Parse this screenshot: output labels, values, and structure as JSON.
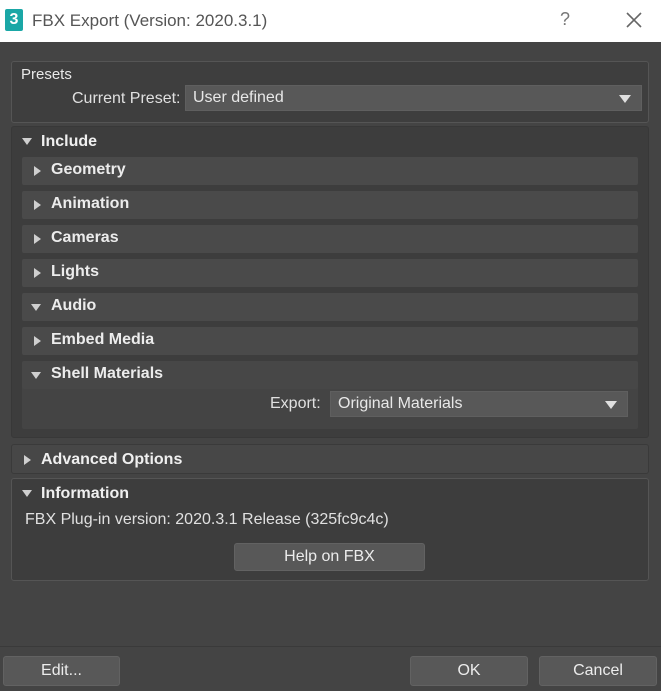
{
  "window": {
    "title": "FBX Export (Version: 2020.3.1)",
    "help_glyph": "?",
    "app_icon_glyph": "3",
    "icons": {
      "app": "3dsmax-app-icon",
      "help": "help-icon",
      "close": "close-icon"
    }
  },
  "presets": {
    "title": "Presets",
    "current_label": "Current Preset:",
    "current_value": "User defined"
  },
  "include": {
    "title": "Include",
    "items": [
      {
        "label": "Geometry",
        "expanded": false
      },
      {
        "label": "Animation",
        "expanded": false
      },
      {
        "label": "Cameras",
        "expanded": false
      },
      {
        "label": "Lights",
        "expanded": false
      },
      {
        "label": "Audio",
        "expanded": true
      },
      {
        "label": "Embed Media",
        "expanded": false
      },
      {
        "label": "Shell Materials",
        "expanded": true
      }
    ],
    "shell_materials": {
      "export_label": "Export:",
      "export_value": "Original Materials"
    }
  },
  "advanced": {
    "title": "Advanced Options"
  },
  "information": {
    "title": "Information",
    "version_text": "FBX Plug-in version: 2020.3.1 Release (325fc9c4c)",
    "help_button": "Help on FBX"
  },
  "footer": {
    "edit_button": "Edit...",
    "ok_button": "OK",
    "cancel_button": "Cancel"
  },
  "colors": {
    "background": "#444444",
    "titlebar": "#ffffff",
    "accent_icon": "#1aa7a6"
  }
}
